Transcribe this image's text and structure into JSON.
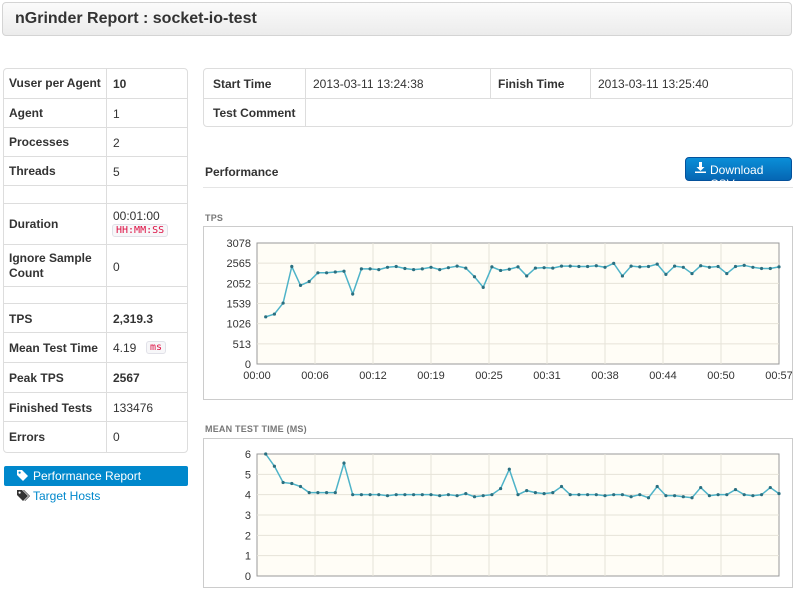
{
  "header": {
    "title": "nGrinder Report : socket-io-test"
  },
  "stats": [
    {
      "key": "Vuser per Agent",
      "value": "10",
      "style": "link"
    },
    {
      "key": "Agent",
      "value": "1"
    },
    {
      "key": "Processes",
      "value": "2"
    },
    {
      "key": "Threads",
      "value": "5"
    },
    {
      "key": "Duration",
      "value": "00:01:00",
      "tag": "HH:MM:SS"
    },
    {
      "key": "Ignore Sample Count",
      "value": "0"
    },
    {
      "key": "TPS",
      "value": "2,319.3",
      "style": "link"
    },
    {
      "key": "Mean Test Time",
      "value": "4.19",
      "tag": "ms"
    },
    {
      "key": "Peak TPS",
      "value": "2567",
      "style": "link"
    },
    {
      "key": "Finished Tests",
      "value": "133476"
    },
    {
      "key": "Errors",
      "value": "0"
    }
  ],
  "nav": {
    "items": [
      {
        "label": "Performance Report",
        "icon": "tag-icon",
        "active": true
      },
      {
        "label": "Target Hosts",
        "icon": "tags-icon",
        "active": false
      }
    ]
  },
  "info": {
    "start_label": "Start Time",
    "start_value": "2013-03-11 13:24:38",
    "finish_label": "Finish Time",
    "finish_value": "2013-03-11 13:25:40",
    "comment_label": "Test Comment",
    "comment_value": ""
  },
  "performance": {
    "title": "Performance",
    "download_label": "Download CSV",
    "download_icon": "download-icon"
  },
  "colors": {
    "series": "#4eb3c8",
    "plot_bg": "#fffdf6",
    "accent": "#0088cc"
  },
  "chart_data": [
    {
      "type": "line",
      "title": "TPS",
      "ylim": [
        0,
        3078
      ],
      "yticks": [
        "0",
        "513",
        "1026",
        "1539",
        "2052",
        "2565",
        "3078"
      ],
      "xticks": [
        "00:00",
        "00:06",
        "00:12",
        "00:19",
        "00:25",
        "00:31",
        "00:38",
        "00:44",
        "00:50",
        "00:57"
      ],
      "grid": true,
      "series": [
        {
          "x": [
            1,
            2,
            3,
            4,
            5,
            6,
            7,
            8,
            9,
            10,
            11,
            12,
            13,
            14,
            15,
            16,
            17,
            18,
            19,
            20,
            21,
            22,
            23,
            24,
            25,
            26,
            27,
            28,
            29,
            30,
            31,
            32,
            33,
            34,
            35,
            36,
            37,
            38,
            39,
            40,
            41,
            42,
            43,
            44,
            45,
            46,
            47,
            48,
            49,
            50,
            51,
            52,
            53,
            54,
            55,
            56,
            57,
            58,
            59,
            60
          ],
          "values": [
            1200,
            1270,
            1550,
            2480,
            2000,
            2100,
            2320,
            2320,
            2340,
            2360,
            1780,
            2420,
            2420,
            2400,
            2460,
            2480,
            2430,
            2400,
            2420,
            2460,
            2400,
            2450,
            2490,
            2440,
            2220,
            1950,
            2470,
            2380,
            2410,
            2470,
            2240,
            2440,
            2450,
            2440,
            2490,
            2490,
            2480,
            2480,
            2500,
            2460,
            2560,
            2240,
            2490,
            2470,
            2480,
            2540,
            2280,
            2490,
            2460,
            2300,
            2500,
            2460,
            2480,
            2300,
            2480,
            2510,
            2460,
            2430,
            2430,
            2470
          ]
        }
      ]
    },
    {
      "type": "line",
      "title": "MEAN TEST TIME (MS)",
      "ylim": [
        0,
        6
      ],
      "yticks": [
        "0",
        "1",
        "2",
        "3",
        "4",
        "5",
        "6"
      ],
      "xticks": [],
      "grid": true,
      "series": [
        {
          "x": [
            1,
            2,
            3,
            4,
            5,
            6,
            7,
            8,
            9,
            10,
            11,
            12,
            13,
            14,
            15,
            16,
            17,
            18,
            19,
            20,
            21,
            22,
            23,
            24,
            25,
            26,
            27,
            28,
            29,
            30,
            31,
            32,
            33,
            34,
            35,
            36,
            37,
            38,
            39,
            40,
            41,
            42,
            43,
            44,
            45,
            46,
            47,
            48,
            49,
            50,
            51,
            52,
            53,
            54,
            55,
            56,
            57,
            58,
            59,
            60
          ],
          "values": [
            6.0,
            5.4,
            4.6,
            4.55,
            4.4,
            4.1,
            4.1,
            4.1,
            4.1,
            5.55,
            4.0,
            4.0,
            4.0,
            4.0,
            3.95,
            4.0,
            4.0,
            4.0,
            4.0,
            4.0,
            3.95,
            4.0,
            3.95,
            4.05,
            3.9,
            3.95,
            4.0,
            4.3,
            5.25,
            4.0,
            4.2,
            4.1,
            4.05,
            4.1,
            4.4,
            4.0,
            4.0,
            4.0,
            4.0,
            3.95,
            4.0,
            4.0,
            3.9,
            4.0,
            3.85,
            4.4,
            3.95,
            3.95,
            3.9,
            3.85,
            4.35,
            3.95,
            4.0,
            4.0,
            4.25,
            4.0,
            3.95,
            4.0,
            4.35,
            4.05
          ]
        }
      ]
    }
  ]
}
